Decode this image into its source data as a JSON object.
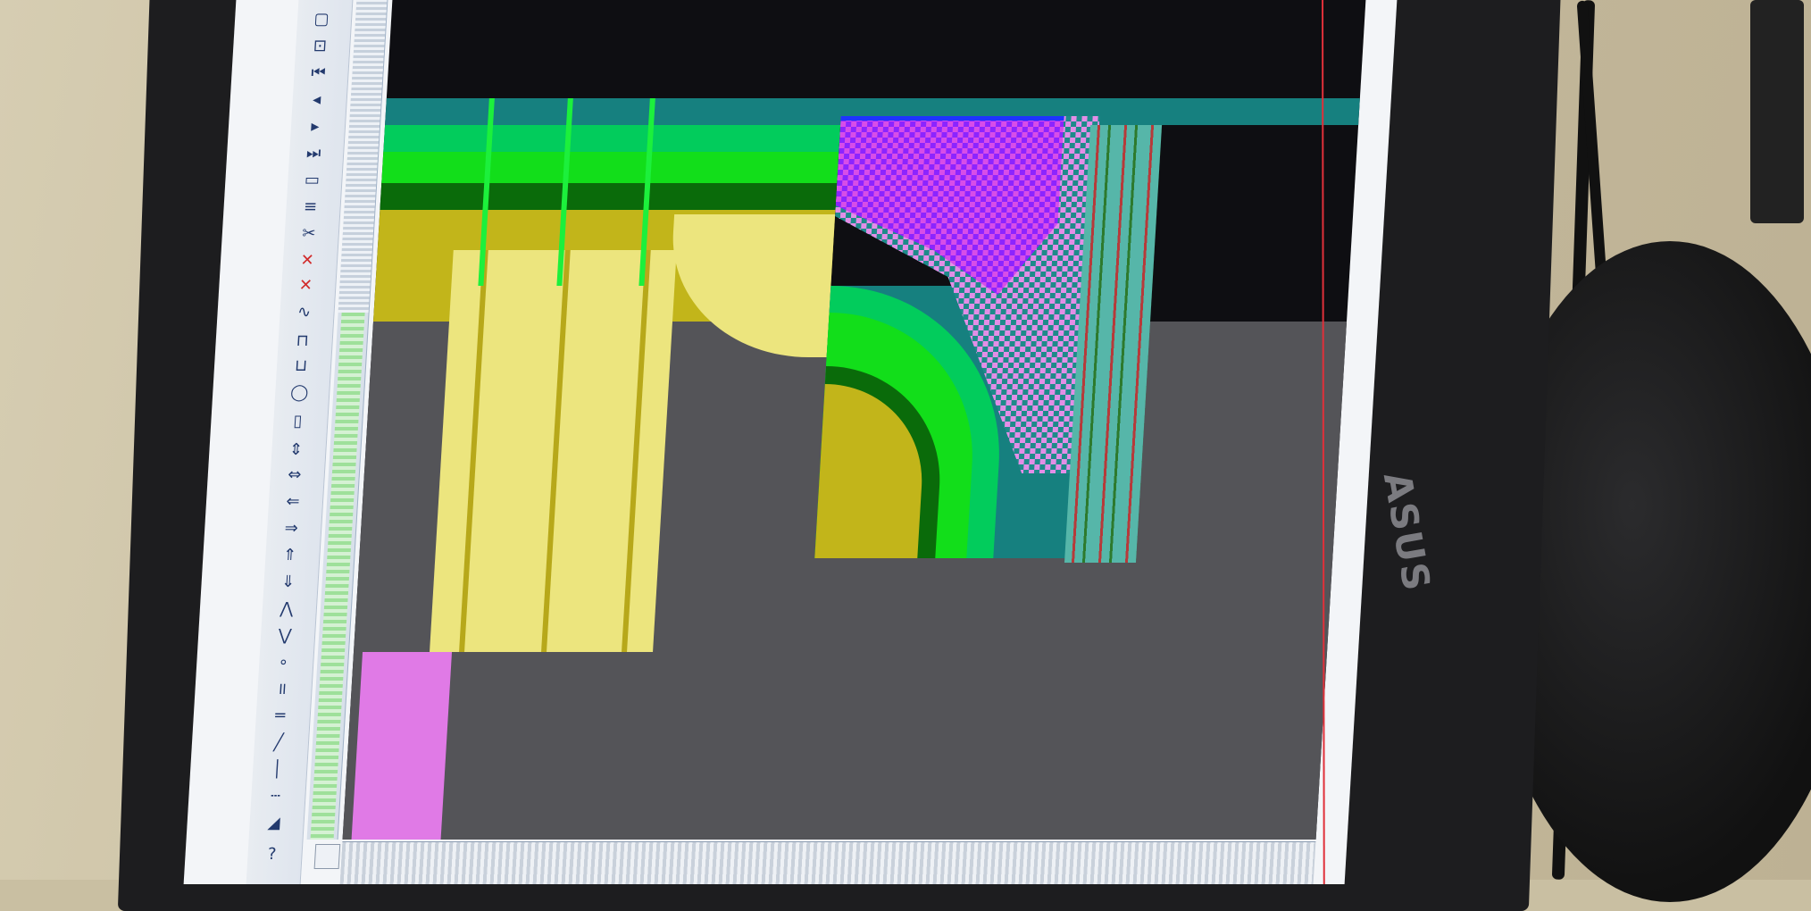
{
  "monitor": {
    "brand": "ASUS"
  },
  "colors": {
    "teal": "#16807f",
    "green_bright": "#02cc5c",
    "green_lime": "#12de1a",
    "green_dark": "#0a6b0a",
    "olive": "#c2b51a",
    "pale_yellow": "#ece57e",
    "gray": "#545458",
    "magenta": "#e07ae6",
    "purple": "#8c24ff",
    "red_cursor": "#e0303a"
  },
  "toolbar": {
    "icons": [
      "select-icon",
      "zoom-icon",
      "first-icon",
      "prev-icon",
      "next-icon",
      "last-icon",
      "window-icon",
      "cut-icon",
      "align-icon",
      "cross-icon",
      "cross-icon",
      "wave-icon",
      "rect-icon",
      "circle-icon",
      "box-icon",
      "resize-icon",
      "left-icon",
      "right-icon",
      "up-icon",
      "down-icon",
      "double-up-icon",
      "double-down-icon",
      "dot-icon",
      "pause-icon",
      "line-icon",
      "line-icon",
      "bar-icon",
      "dash-icon",
      "triangle-icon",
      "help-icon"
    ]
  }
}
